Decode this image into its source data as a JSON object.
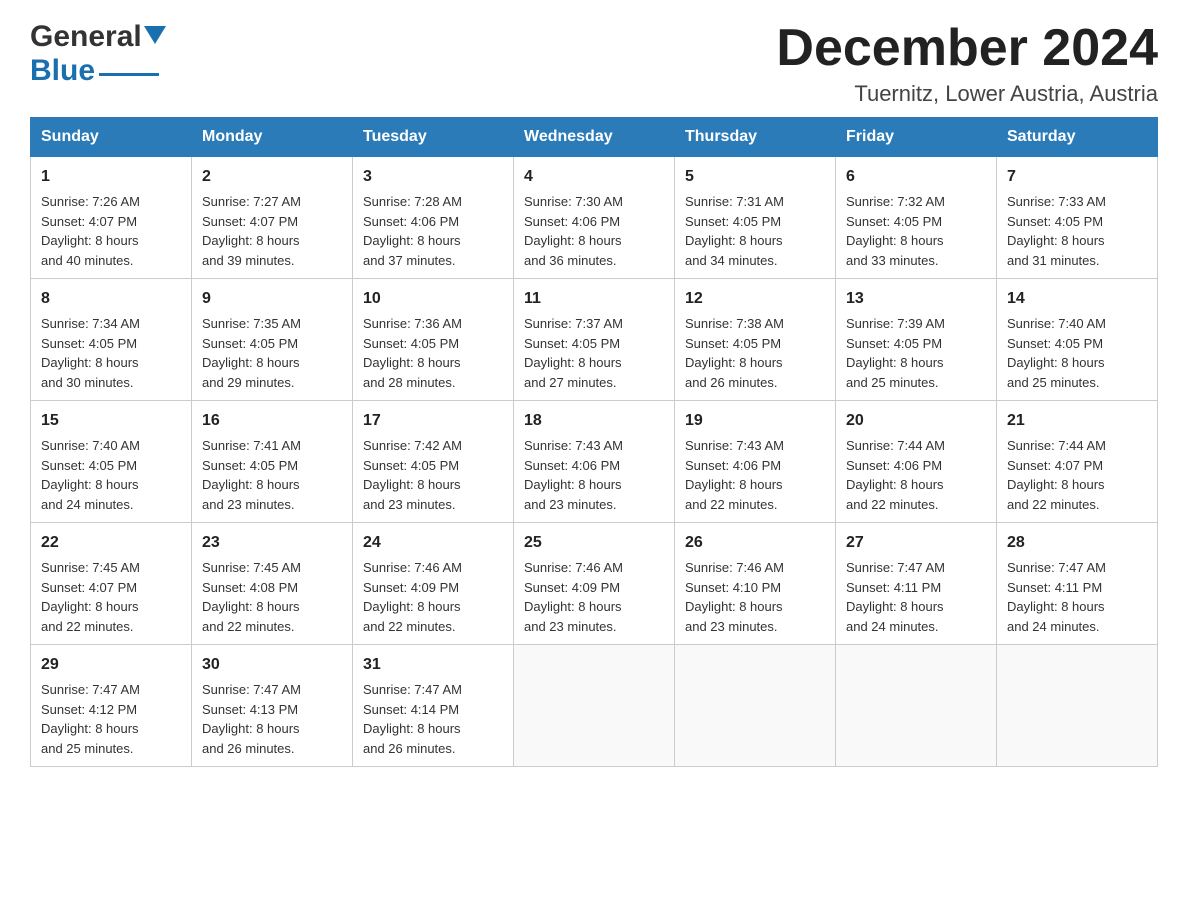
{
  "header": {
    "logo_general": "General",
    "logo_blue": "Blue",
    "month_title": "December 2024",
    "subtitle": "Tuernitz, Lower Austria, Austria"
  },
  "days_of_week": [
    "Sunday",
    "Monday",
    "Tuesday",
    "Wednesday",
    "Thursday",
    "Friday",
    "Saturday"
  ],
  "weeks": [
    [
      {
        "day": "1",
        "sunrise": "7:26 AM",
        "sunset": "4:07 PM",
        "daylight": "8 hours and 40 minutes."
      },
      {
        "day": "2",
        "sunrise": "7:27 AM",
        "sunset": "4:07 PM",
        "daylight": "8 hours and 39 minutes."
      },
      {
        "day": "3",
        "sunrise": "7:28 AM",
        "sunset": "4:06 PM",
        "daylight": "8 hours and 37 minutes."
      },
      {
        "day": "4",
        "sunrise": "7:30 AM",
        "sunset": "4:06 PM",
        "daylight": "8 hours and 36 minutes."
      },
      {
        "day": "5",
        "sunrise": "7:31 AM",
        "sunset": "4:05 PM",
        "daylight": "8 hours and 34 minutes."
      },
      {
        "day": "6",
        "sunrise": "7:32 AM",
        "sunset": "4:05 PM",
        "daylight": "8 hours and 33 minutes."
      },
      {
        "day": "7",
        "sunrise": "7:33 AM",
        "sunset": "4:05 PM",
        "daylight": "8 hours and 31 minutes."
      }
    ],
    [
      {
        "day": "8",
        "sunrise": "7:34 AM",
        "sunset": "4:05 PM",
        "daylight": "8 hours and 30 minutes."
      },
      {
        "day": "9",
        "sunrise": "7:35 AM",
        "sunset": "4:05 PM",
        "daylight": "8 hours and 29 minutes."
      },
      {
        "day": "10",
        "sunrise": "7:36 AM",
        "sunset": "4:05 PM",
        "daylight": "8 hours and 28 minutes."
      },
      {
        "day": "11",
        "sunrise": "7:37 AM",
        "sunset": "4:05 PM",
        "daylight": "8 hours and 27 minutes."
      },
      {
        "day": "12",
        "sunrise": "7:38 AM",
        "sunset": "4:05 PM",
        "daylight": "8 hours and 26 minutes."
      },
      {
        "day": "13",
        "sunrise": "7:39 AM",
        "sunset": "4:05 PM",
        "daylight": "8 hours and 25 minutes."
      },
      {
        "day": "14",
        "sunrise": "7:40 AM",
        "sunset": "4:05 PM",
        "daylight": "8 hours and 25 minutes."
      }
    ],
    [
      {
        "day": "15",
        "sunrise": "7:40 AM",
        "sunset": "4:05 PM",
        "daylight": "8 hours and 24 minutes."
      },
      {
        "day": "16",
        "sunrise": "7:41 AM",
        "sunset": "4:05 PM",
        "daylight": "8 hours and 23 minutes."
      },
      {
        "day": "17",
        "sunrise": "7:42 AM",
        "sunset": "4:05 PM",
        "daylight": "8 hours and 23 minutes."
      },
      {
        "day": "18",
        "sunrise": "7:43 AM",
        "sunset": "4:06 PM",
        "daylight": "8 hours and 23 minutes."
      },
      {
        "day": "19",
        "sunrise": "7:43 AM",
        "sunset": "4:06 PM",
        "daylight": "8 hours and 22 minutes."
      },
      {
        "day": "20",
        "sunrise": "7:44 AM",
        "sunset": "4:06 PM",
        "daylight": "8 hours and 22 minutes."
      },
      {
        "day": "21",
        "sunrise": "7:44 AM",
        "sunset": "4:07 PM",
        "daylight": "8 hours and 22 minutes."
      }
    ],
    [
      {
        "day": "22",
        "sunrise": "7:45 AM",
        "sunset": "4:07 PM",
        "daylight": "8 hours and 22 minutes."
      },
      {
        "day": "23",
        "sunrise": "7:45 AM",
        "sunset": "4:08 PM",
        "daylight": "8 hours and 22 minutes."
      },
      {
        "day": "24",
        "sunrise": "7:46 AM",
        "sunset": "4:09 PM",
        "daylight": "8 hours and 22 minutes."
      },
      {
        "day": "25",
        "sunrise": "7:46 AM",
        "sunset": "4:09 PM",
        "daylight": "8 hours and 23 minutes."
      },
      {
        "day": "26",
        "sunrise": "7:46 AM",
        "sunset": "4:10 PM",
        "daylight": "8 hours and 23 minutes."
      },
      {
        "day": "27",
        "sunrise": "7:47 AM",
        "sunset": "4:11 PM",
        "daylight": "8 hours and 24 minutes."
      },
      {
        "day": "28",
        "sunrise": "7:47 AM",
        "sunset": "4:11 PM",
        "daylight": "8 hours and 24 minutes."
      }
    ],
    [
      {
        "day": "29",
        "sunrise": "7:47 AM",
        "sunset": "4:12 PM",
        "daylight": "8 hours and 25 minutes."
      },
      {
        "day": "30",
        "sunrise": "7:47 AM",
        "sunset": "4:13 PM",
        "daylight": "8 hours and 26 minutes."
      },
      {
        "day": "31",
        "sunrise": "7:47 AM",
        "sunset": "4:14 PM",
        "daylight": "8 hours and 26 minutes."
      },
      null,
      null,
      null,
      null
    ]
  ],
  "labels": {
    "sunrise": "Sunrise:",
    "sunset": "Sunset:",
    "daylight": "Daylight:"
  }
}
